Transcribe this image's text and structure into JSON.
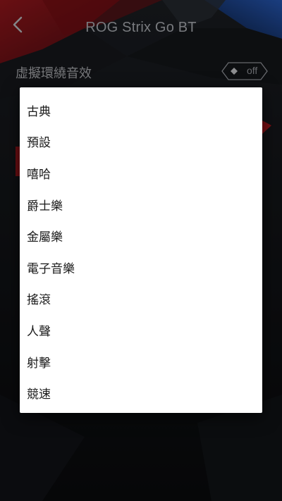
{
  "header": {
    "title": "ROG Strix Go BT",
    "back_icon": "chevron-left-icon"
  },
  "setting": {
    "label": "虛擬環繞音效",
    "toggle_state": "off"
  },
  "colors": {
    "accent_red": "#a3161c",
    "accent_blue": "#1f4fa8",
    "background": "#101215",
    "dialog_bg": "#ffffff",
    "text_light": "#b9bcc2"
  },
  "dialog": {
    "options": [
      {
        "label": "古典"
      },
      {
        "label": "預設"
      },
      {
        "label": "嘻哈"
      },
      {
        "label": "爵士樂"
      },
      {
        "label": "金屬樂"
      },
      {
        "label": "電子音樂"
      },
      {
        "label": "搖滾"
      },
      {
        "label": "人聲"
      },
      {
        "label": "射擊"
      },
      {
        "label": "競速"
      }
    ]
  }
}
